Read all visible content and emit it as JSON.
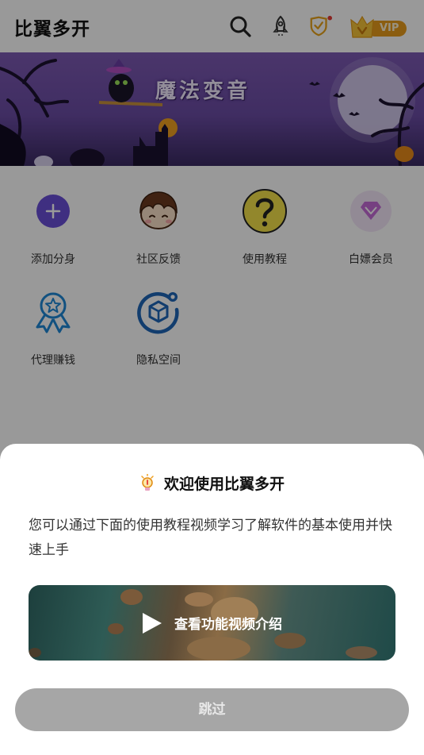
{
  "header": {
    "title": "比翼多开",
    "vip_label": "VIP",
    "icons": [
      "search-icon",
      "rocket-icon",
      "shield-check-icon",
      "vip-crown-icon"
    ]
  },
  "banner": {
    "title": "魔法变音"
  },
  "grid": {
    "items": [
      {
        "label": "添加分身",
        "icon": "plus-circle-icon"
      },
      {
        "label": "社区反馈",
        "icon": "cartoon-face-icon"
      },
      {
        "label": "使用教程",
        "icon": "question-icon"
      },
      {
        "label": "白嫖会员",
        "icon": "gem-icon"
      },
      {
        "label": "代理赚钱",
        "icon": "award-ribbon-icon"
      },
      {
        "label": "隐私空间",
        "icon": "privacy-box-icon"
      }
    ]
  },
  "dialog": {
    "title": "欢迎使用比翼多开",
    "description": "您可以通过下面的使用教程视频学习了解软件的基本使用并快速上手",
    "video_label": "查看功能视频介绍",
    "skip_label": "跳过"
  },
  "colors": {
    "accent_purple": "#6a4fd8",
    "banner_purple": "#6b4ca4",
    "vip_gold": "#f2b233",
    "skip_button_gray": "#a6a6a6"
  }
}
